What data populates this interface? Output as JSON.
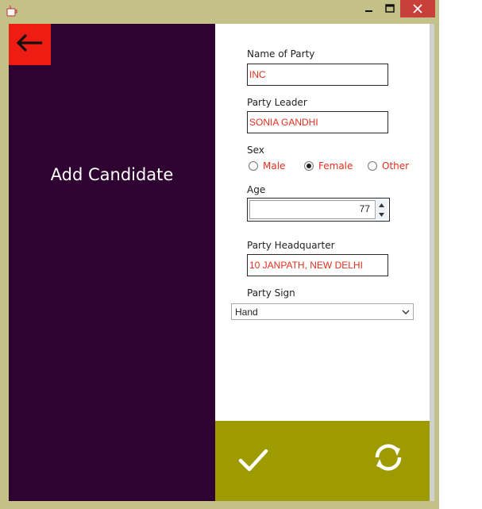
{
  "window": {
    "title": ""
  },
  "left_panel": {
    "title": "Add Candidate",
    "accent": "#2e0331",
    "back_color": "#ee1c13"
  },
  "form": {
    "name_of_party": {
      "label": "Name of Party",
      "value": "INC"
    },
    "party_leader": {
      "label": "Party Leader",
      "value": "SONIA GANDHI"
    },
    "sex": {
      "label": "Sex",
      "options": [
        "Male",
        "Female",
        "Other"
      ],
      "selected": "Female"
    },
    "age": {
      "label": "Age",
      "value": "77"
    },
    "party_headquarter": {
      "label": "Party Headquarter",
      "value": "10 JANPATH, NEW DELHI"
    },
    "party_sign": {
      "label": "Party Sign",
      "selected": "Hand"
    }
  },
  "actions": {
    "bar_color": "#9e9b00",
    "icons": [
      "check-icon",
      "refresh-icon"
    ]
  }
}
